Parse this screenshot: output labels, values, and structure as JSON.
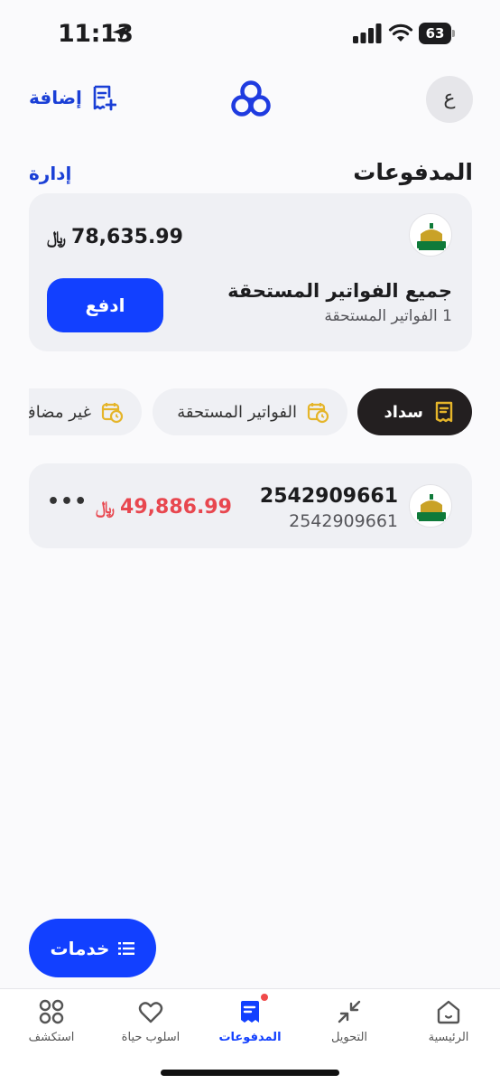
{
  "status_bar": {
    "time": "11:13",
    "battery": "63"
  },
  "header": {
    "avatar_letter": "ع",
    "add_label": "إضافة"
  },
  "section": {
    "title": "المدفوعات",
    "manage_label": "إدارة"
  },
  "summary": {
    "amount": "78,635.99",
    "currency_symbol": "﷼",
    "title": "جميع الفواتير المستحقة",
    "subtitle": "1 الفواتير المستحقة",
    "pay_label": "ادفع"
  },
  "chips": [
    {
      "label": "سداد",
      "active": true,
      "icon": "bill-icon"
    },
    {
      "label": "الفواتير المستحقة",
      "active": false,
      "icon": "calendar-clock-icon"
    },
    {
      "label": "غير مضاف",
      "active": false,
      "icon": "calendar-clock-icon"
    }
  ],
  "bill": {
    "number": "2542909661",
    "subtitle": "2542909661",
    "amount": "49,886.99",
    "currency_symbol": "﷼",
    "more_label": "•••"
  },
  "fab": {
    "label": "خدمات",
    "icon": "list-icon"
  },
  "bottom_nav": [
    {
      "label": "الرئيسية",
      "icon": "home-icon",
      "active": false
    },
    {
      "label": "التحويل",
      "icon": "transfer-icon",
      "active": false
    },
    {
      "label": "المدفوعات",
      "icon": "payments-icon",
      "active": true
    },
    {
      "label": "اسلوب حياة",
      "icon": "heart-icon",
      "active": false
    },
    {
      "label": "استكشف",
      "icon": "grid-icon",
      "active": false
    }
  ],
  "colors": {
    "accent": "#1240ff",
    "link": "#1a3fd6",
    "negative": "#e8474f",
    "chip_active": "#231f20",
    "card_bg": "#eff0f4"
  }
}
